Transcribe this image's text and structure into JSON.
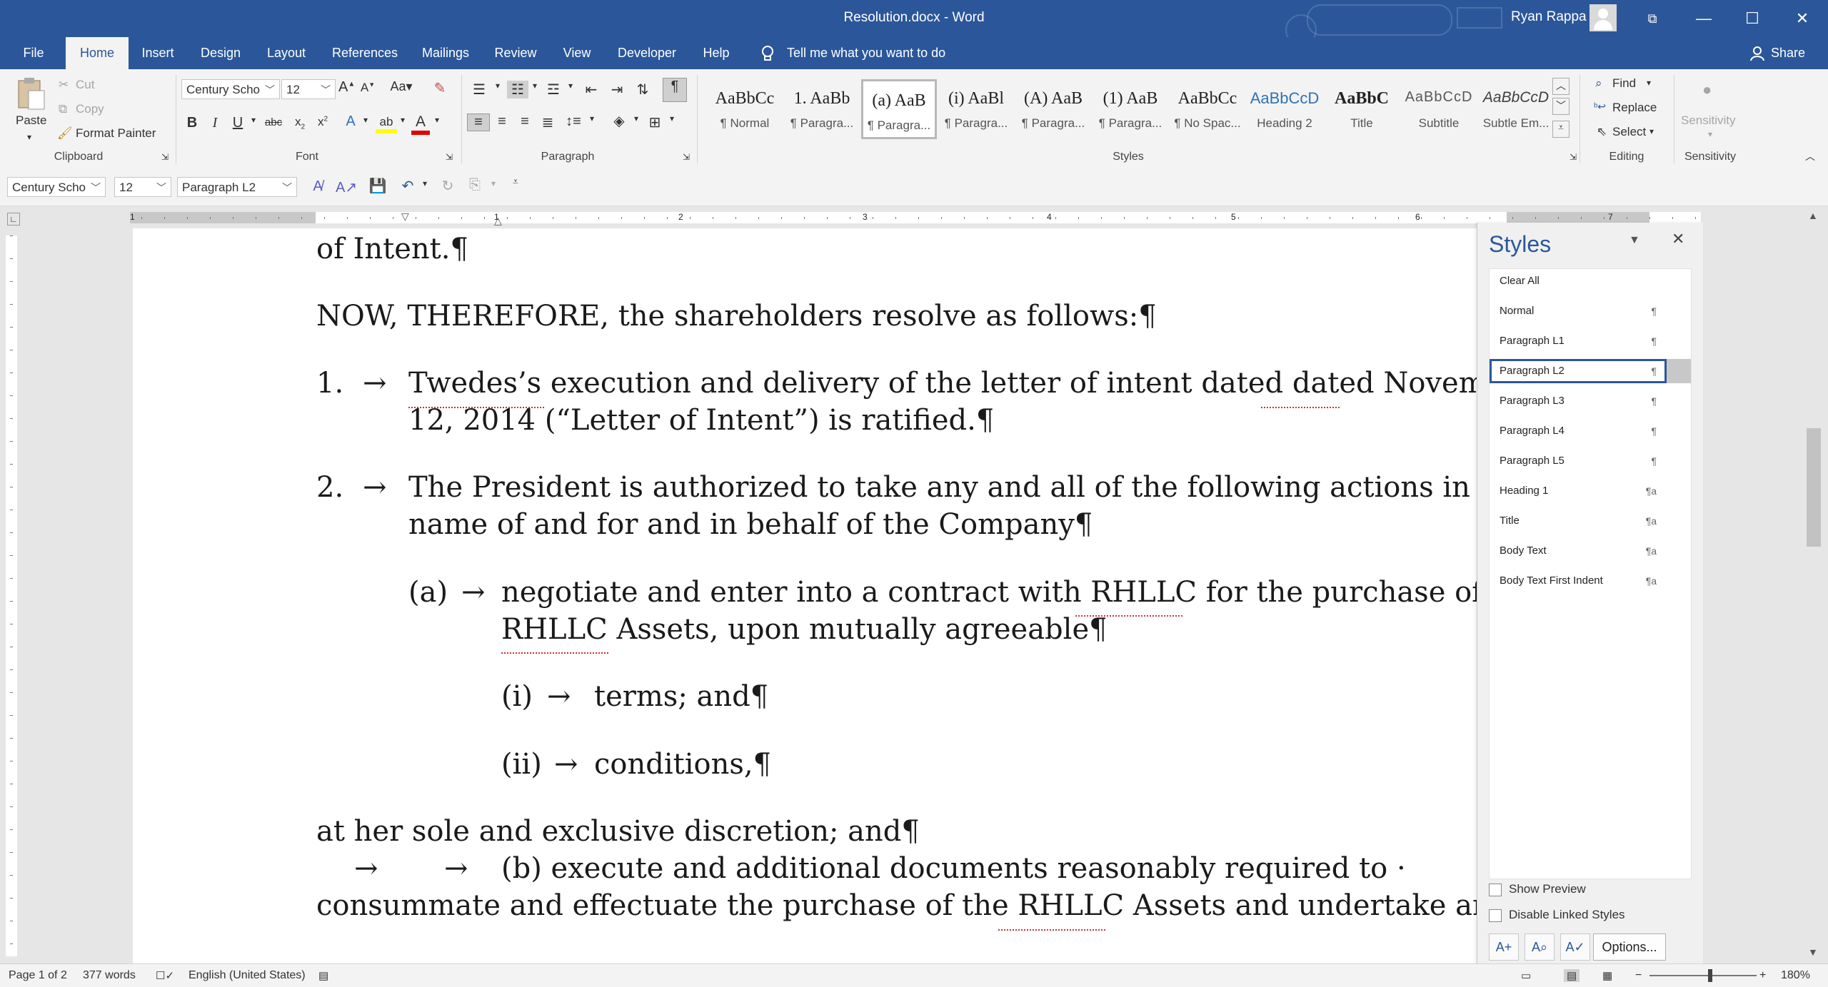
{
  "window": {
    "title": "Resolution.docx  -  Word",
    "user": "Ryan Rappa"
  },
  "tabs": [
    "File",
    "Home",
    "Insert",
    "Design",
    "Layout",
    "References",
    "Mailings",
    "Review",
    "View",
    "Developer",
    "Help"
  ],
  "tell_me": "Tell me what you want to do",
  "share": "Share",
  "ribbon": {
    "clipboard": {
      "paste": "Paste",
      "cut": "Cut",
      "copy": "Copy",
      "format_painter": "Format Painter",
      "label": "Clipboard"
    },
    "font": {
      "name": "Century Scho",
      "size": "12",
      "label": "Font"
    },
    "paragraph": {
      "label": "Paragraph"
    },
    "styles": {
      "label": "Styles",
      "gallery": [
        {
          "preview": "AaBbCc",
          "name": "¶ Normal"
        },
        {
          "preview": "1.  AaBb",
          "name": "¶ Paragra..."
        },
        {
          "preview": "(a)  AaB",
          "name": "¶ Paragra..."
        },
        {
          "preview": "(i)  AaBl",
          "name": "¶ Paragra..."
        },
        {
          "preview": "(A)  AaB",
          "name": "¶ Paragra..."
        },
        {
          "preview": "(1)  AaB",
          "name": "¶ Paragra..."
        },
        {
          "preview": "AaBbCc",
          "name": "¶ No Spac..."
        },
        {
          "preview": "AaBbCcD",
          "name": "Heading 2"
        },
        {
          "preview": "AaBbC",
          "name": "Title"
        },
        {
          "preview": "AaBbCcD",
          "name": "Subtitle"
        },
        {
          "preview": "AaBbCcD",
          "name": "Subtle Em..."
        }
      ]
    },
    "editing": {
      "find": "Find",
      "replace": "Replace",
      "select": "Select",
      "label": "Editing"
    },
    "sensitivity": {
      "button": "Sensitivity",
      "label": "Sensitivity"
    }
  },
  "qat": {
    "font": "Century Scho",
    "size": "12",
    "style": "Paragraph L2"
  },
  "document": {
    "lines": [
      "of Intent.¶",
      "NOW, THEREFORE, the shareholders resolve as follows:¶",
      "1.",
      "Twedes’s execution and delivery of the letter of intent dated dated Novemb",
      "12, 2014 (“Letter of Intent”) is ratified.¶",
      "2.",
      "The President is authorized to take any and all of the following actions in th",
      "name of and for and in behalf of the Company¶",
      "(a)",
      "negotiate and enter into a contract with RHLLC for the purchase of t",
      "RHLLC Assets, upon mutually agreeable¶",
      "(i)",
      "terms; and¶",
      "(ii)",
      "conditions,¶",
      "at her sole and exclusive discretion; and¶",
      "(b) execute and additional documents reasonably required to ·",
      "consummate and effectuate the purchase of the RHLLC Assets and undertake any"
    ],
    "tab_arrow": "→"
  },
  "styles_pane": {
    "title": "Styles",
    "items": [
      "Clear All",
      "Normal",
      "Paragraph L1",
      "Paragraph L2",
      "Paragraph L3",
      "Paragraph L4",
      "Paragraph L5",
      "Heading 1",
      "Title",
      "Body Text",
      "Body Text First Indent"
    ],
    "selected": "Paragraph L2",
    "show_preview": "Show Preview",
    "disable_linked": "Disable Linked Styles",
    "options": "Options..."
  },
  "status": {
    "page": "Page 1 of 2",
    "words": "377 words",
    "language": "English (United States)",
    "zoom": "180%"
  },
  "ruler_numbers": [
    "1",
    "1",
    "2",
    "3",
    "4",
    "5",
    "6",
    "7"
  ],
  "colors": {
    "accent": "#2b579a",
    "ribbon": "#f3f3f3",
    "squiggle": "#d32f2f"
  }
}
